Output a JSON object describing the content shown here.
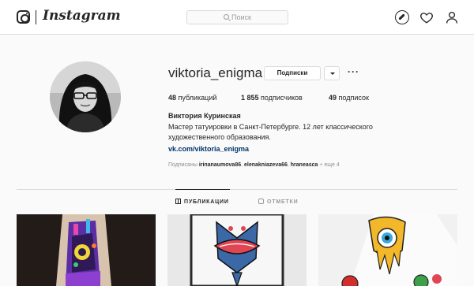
{
  "header": {
    "brand": "Instagram",
    "search_placeholder": "Поиск"
  },
  "profile": {
    "username": "viktoria_enigma",
    "follow_label": "Подписки",
    "more_label": "···",
    "stats": {
      "posts_count": "48",
      "posts_label": "публикаций",
      "followers_count": "1 855",
      "followers_label": "подписчиков",
      "following_count": "49",
      "following_label": "подписок"
    },
    "full_name": "Виктория Куринская",
    "bio": "Мастер татуировки в Санкт-Петербурге. 12 лет классического художественного образования.",
    "link": "vk.com/viktoria_enigma",
    "followed_by": {
      "prefix": "Подписаны",
      "user1": "irinanaumova86",
      "user2": "elenakniazeva66",
      "user3": "hraneasca",
      "suffix": "+ еще 4"
    }
  },
  "tabs": {
    "posts": "ПУБЛИКАЦИИ",
    "tagged": "ОТМЕТКИ"
  },
  "icons": {
    "compass": "compass-icon",
    "heart": "heart-icon",
    "profile": "user-icon"
  }
}
